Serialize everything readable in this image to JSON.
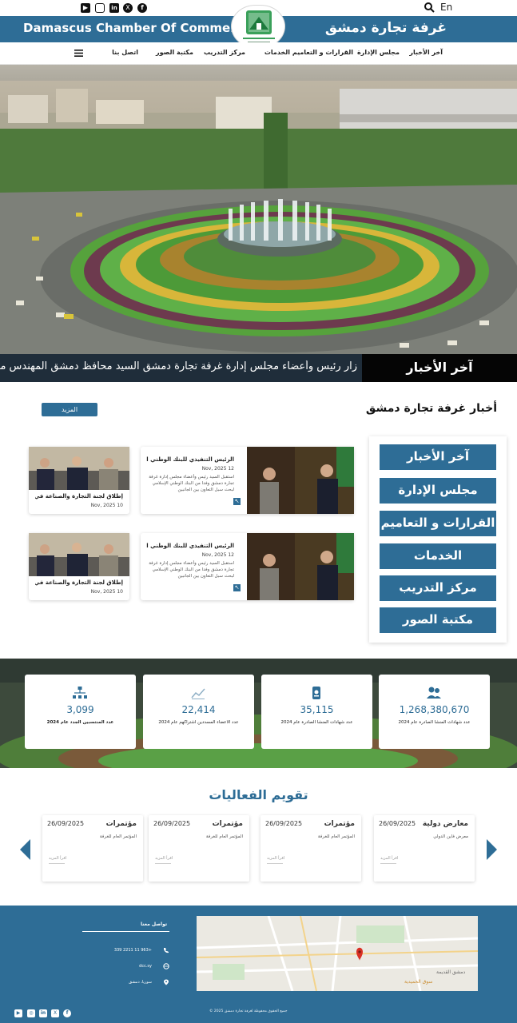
{
  "topbar": {
    "social": [
      "youtube-icon",
      "instagram-icon",
      "linkedin-icon",
      "x-icon",
      "facebook-icon"
    ],
    "language": "En"
  },
  "header": {
    "title_en": "Damascus Chamber Of Commerce",
    "title_ar": "غرفة تجارة دمشق"
  },
  "nav": {
    "items": [
      "آخر الأخبار",
      "مجلس الإدارة",
      "القرارات و التعاميم",
      "الخدمات",
      "مركز التدريب",
      "مكتبة الصور",
      "اتصل بنا"
    ]
  },
  "ticker": {
    "label": "آخر الأخبار",
    "text": "زار رئيس وأعضاء مجلس إدارة غرفة تجارة دمشق السيد محافظ دمشق المهندس محمد"
  },
  "news": {
    "section_title": "أخبار غرفة تجارة دمشق",
    "more_label": "المزيد",
    "cards": [
      {
        "title": "الرئيس التنفيذي للبنك الوطني الإسلامي",
        "date": "12 Nov, 2025",
        "text": "استقبل السيد رئيس وأعضاء مجلس إدارة غرفة تجارة دمشق وفدا من البنك الوطني الإسلامي لبحث سبل التعاون بين الجانبين"
      },
      {
        "title": "إطلاق لجنة التجارة والصناعة في الغرفة",
        "date": "10 Nov, 2025",
        "text": ""
      },
      {
        "title": "الرئيس التنفيذي للبنك الوطني الإسلامي",
        "date": "12 Nov, 2025",
        "text": "استقبل السيد رئيس وأعضاء مجلس إدارة غرفة تجارة دمشق وفدا من البنك الوطني الإسلامي لبحث سبل التعاون بين الجانبين"
      },
      {
        "title": "إطلاق لجنة التجارة والصناعة في الغرفة",
        "date": "10 Nov, 2025",
        "text": ""
      }
    ]
  },
  "side_menu": {
    "items": [
      "آخر الأخبار",
      "مجلس الإدارة",
      "القرارات و التعاميم",
      "الخدمات",
      "مركز التدريب",
      "مكتبة الصور"
    ]
  },
  "stats": [
    {
      "icon": "members-icon",
      "value": "1,268,380,670",
      "label": "عدد شهادات المنشأ الصادرة عام 2024"
    },
    {
      "icon": "certificate-icon",
      "value": "35,115",
      "label": "عدد شهادات المنشأ الصادرة عام 2024"
    },
    {
      "icon": "chart-icon",
      "value": "22,414",
      "label": "عدد الأعضاء المسددين اشتراكهم عام 2024"
    },
    {
      "icon": "hierarchy-icon",
      "value": "3,099",
      "label": "عدد المنتسبين الجدد عام 2024"
    }
  ],
  "events": {
    "title": "تقويم الفعاليات",
    "items": [
      {
        "type": "معارض دولية",
        "date": "26/09/2025",
        "title": "معرض فاين الدولي",
        "link": "اقرأ المزيد"
      },
      {
        "type": "مؤتمرات",
        "date": "26/09/2025",
        "title": "المؤتمر العام للغرفة",
        "link": "اقرأ المزيد"
      },
      {
        "type": "مؤتمرات",
        "date": "26/09/2025",
        "title": "المؤتمر العام للغرفة",
        "link": "اقرأ المزيد"
      },
      {
        "type": "مؤتمرات",
        "date": "26/09/2025",
        "title": "المؤتمر العام للغرفة",
        "link": "اقرأ المزيد"
      }
    ]
  },
  "footer": {
    "contact_title": "تواصل معنا",
    "phone": "+963 11 2211 339",
    "website": "dcc.sy",
    "address": "سوريا، دمشق",
    "copyright": "© 2025 جميع الحقوق محفوظة لغرفة تجارة دمشق",
    "map_labels": [
      "دمشق القديمة",
      "سوق الحميدية"
    ]
  },
  "colors": {
    "brand": "#2e6d96",
    "ticker_bg": "#050505",
    "accent_gold": "#d8b63a"
  }
}
